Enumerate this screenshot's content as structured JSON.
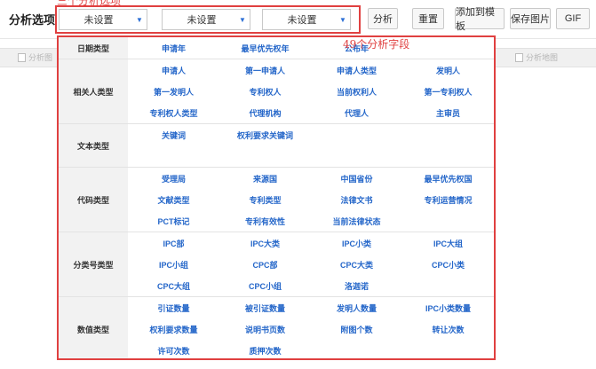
{
  "toolbar": {
    "title": "分析选项",
    "selects": [
      "未设置",
      "未设置",
      "未设置"
    ],
    "buttons": [
      "分析",
      "重置",
      "添加到模板",
      "保存图片",
      "GIF"
    ]
  },
  "annotations": {
    "options_label": "三个分析选项",
    "fields_label": "49个分析字段"
  },
  "background_tabs": [
    "分析图",
    "分析地图"
  ],
  "categories": [
    {
      "label": "日期类型",
      "fields": [
        "申请年",
        "最早优先权年",
        "公布年"
      ]
    },
    {
      "label": "相关人类型",
      "fields": [
        "申请人",
        "第一申请人",
        "申请人类型",
        "发明人",
        "第一发明人",
        "专利权人",
        "当前权利人",
        "第一专利权人",
        "专利权人类型",
        "代理机构",
        "代理人",
        "主审员"
      ]
    },
    {
      "label": "文本类型",
      "fields": [
        "关键词",
        "权利要求关键词"
      ]
    },
    {
      "label": "代码类型",
      "fields": [
        "受理局",
        "来源国",
        "中国省份",
        "最早优先权国",
        "文献类型",
        "专利类型",
        "法律文书",
        "专利运营情况",
        "PCT标记",
        "专利有效性",
        "当前法律状态"
      ]
    },
    {
      "label": "分类号类型",
      "fields": [
        "IPC部",
        "IPC大类",
        "IPC小类",
        "IPC大组",
        "IPC小组",
        "CPC部",
        "CPC大类",
        "CPC小类",
        "CPC大组",
        "CPC小组",
        "洛迦诺"
      ]
    },
    {
      "label": "数值类型",
      "fields": [
        "引证数量",
        "被引证数量",
        "发明人数量",
        "IPC小类数量",
        "权利要求数量",
        "说明书页数",
        "附图个数",
        "转让次数",
        "许可次数",
        "质押次数"
      ]
    }
  ],
  "colors": {
    "field_link": "#2466c9",
    "annotation": "#e04040",
    "select_caret": "#2c6fd6"
  }
}
